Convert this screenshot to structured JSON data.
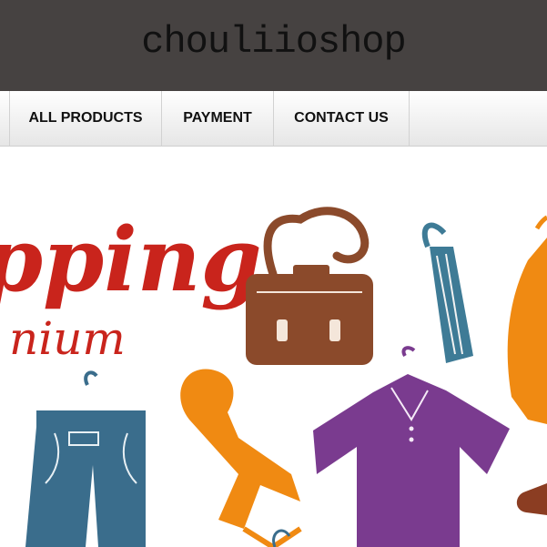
{
  "header": {
    "site_title": "chouliioshop"
  },
  "nav": {
    "items": [
      {
        "label": "ALL PRODUCTS"
      },
      {
        "label": "PAYMENT"
      },
      {
        "label": "CONTACT US"
      }
    ]
  },
  "banner": {
    "script_text_1": "pping",
    "script_text_2": "nium"
  },
  "colors": {
    "header_bg": "#464241",
    "script_red": "#c9241c",
    "bag_brown": "#8b4a2b",
    "umbrella_teal": "#3e7b96",
    "scarf_orange": "#f08a12",
    "shirt_purple": "#7a3b8f",
    "jeans_blue": "#3a6d8c"
  }
}
